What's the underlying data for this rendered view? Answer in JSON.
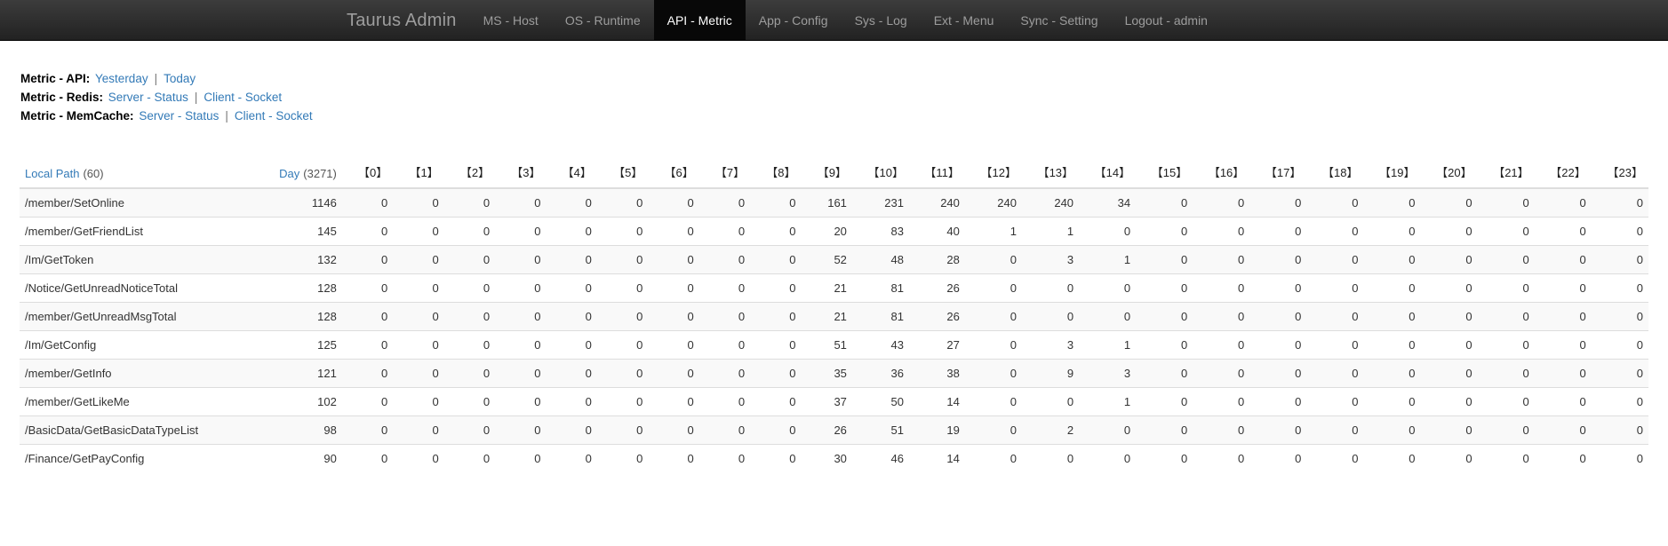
{
  "navbar": {
    "brand": "Taurus Admin",
    "items": [
      {
        "label": "MS - Host",
        "active": false
      },
      {
        "label": "OS - Runtime",
        "active": false
      },
      {
        "label": "API - Metric",
        "active": true
      },
      {
        "label": "App - Config",
        "active": false
      },
      {
        "label": "Sys - Log",
        "active": false
      },
      {
        "label": "Ext - Menu",
        "active": false
      },
      {
        "label": "Sync - Setting",
        "active": false
      },
      {
        "label": "Logout - admin",
        "active": false
      }
    ]
  },
  "metric_links": [
    {
      "label": "Metric - API:",
      "links": [
        "Yesterday",
        "Today"
      ],
      "separator": "|"
    },
    {
      "label": "Metric - Redis:",
      "links": [
        "Server - Status",
        "Client - Socket"
      ],
      "separator": "|"
    },
    {
      "label": "Metric - MemCache:",
      "links": [
        "Server - Status",
        "Client - Socket"
      ],
      "separator": "|"
    }
  ],
  "table": {
    "header": {
      "path_label": "Local Path",
      "path_count": "(60)",
      "day_label": "Day",
      "day_count": "(3271)",
      "hours": [
        "【0】",
        "【1】",
        "【2】",
        "【3】",
        "【4】",
        "【5】",
        "【6】",
        "【7】",
        "【8】",
        "【9】",
        "【10】",
        "【11】",
        "【12】",
        "【13】",
        "【14】",
        "【15】",
        "【16】",
        "【17】",
        "【18】",
        "【19】",
        "【20】",
        "【21】",
        "【22】",
        "【23】"
      ]
    },
    "rows": [
      {
        "path": "/member/SetOnline",
        "day": "1146",
        "hours": [
          "0",
          "0",
          "0",
          "0",
          "0",
          "0",
          "0",
          "0",
          "0",
          "161",
          "231",
          "240",
          "240",
          "240",
          "34",
          "0",
          "0",
          "0",
          "0",
          "0",
          "0",
          "0",
          "0",
          "0"
        ]
      },
      {
        "path": "/member/GetFriendList",
        "day": "145",
        "hours": [
          "0",
          "0",
          "0",
          "0",
          "0",
          "0",
          "0",
          "0",
          "0",
          "20",
          "83",
          "40",
          "1",
          "1",
          "0",
          "0",
          "0",
          "0",
          "0",
          "0",
          "0",
          "0",
          "0",
          "0"
        ]
      },
      {
        "path": "/Im/GetToken",
        "day": "132",
        "hours": [
          "0",
          "0",
          "0",
          "0",
          "0",
          "0",
          "0",
          "0",
          "0",
          "52",
          "48",
          "28",
          "0",
          "3",
          "1",
          "0",
          "0",
          "0",
          "0",
          "0",
          "0",
          "0",
          "0",
          "0"
        ]
      },
      {
        "path": "/Notice/GetUnreadNoticeTotal",
        "day": "128",
        "hours": [
          "0",
          "0",
          "0",
          "0",
          "0",
          "0",
          "0",
          "0",
          "0",
          "21",
          "81",
          "26",
          "0",
          "0",
          "0",
          "0",
          "0",
          "0",
          "0",
          "0",
          "0",
          "0",
          "0",
          "0"
        ]
      },
      {
        "path": "/member/GetUnreadMsgTotal",
        "day": "128",
        "hours": [
          "0",
          "0",
          "0",
          "0",
          "0",
          "0",
          "0",
          "0",
          "0",
          "21",
          "81",
          "26",
          "0",
          "0",
          "0",
          "0",
          "0",
          "0",
          "0",
          "0",
          "0",
          "0",
          "0",
          "0"
        ]
      },
      {
        "path": "/Im/GetConfig",
        "day": "125",
        "hours": [
          "0",
          "0",
          "0",
          "0",
          "0",
          "0",
          "0",
          "0",
          "0",
          "51",
          "43",
          "27",
          "0",
          "3",
          "1",
          "0",
          "0",
          "0",
          "0",
          "0",
          "0",
          "0",
          "0",
          "0"
        ]
      },
      {
        "path": "/member/GetInfo",
        "day": "121",
        "hours": [
          "0",
          "0",
          "0",
          "0",
          "0",
          "0",
          "0",
          "0",
          "0",
          "35",
          "36",
          "38",
          "0",
          "9",
          "3",
          "0",
          "0",
          "0",
          "0",
          "0",
          "0",
          "0",
          "0",
          "0"
        ]
      },
      {
        "path": "/member/GetLikeMe",
        "day": "102",
        "hours": [
          "0",
          "0",
          "0",
          "0",
          "0",
          "0",
          "0",
          "0",
          "0",
          "37",
          "50",
          "14",
          "0",
          "0",
          "1",
          "0",
          "0",
          "0",
          "0",
          "0",
          "0",
          "0",
          "0",
          "0"
        ]
      },
      {
        "path": "/BasicData/GetBasicDataTypeList",
        "day": "98",
        "hours": [
          "0",
          "0",
          "0",
          "0",
          "0",
          "0",
          "0",
          "0",
          "0",
          "26",
          "51",
          "19",
          "0",
          "2",
          "0",
          "0",
          "0",
          "0",
          "0",
          "0",
          "0",
          "0",
          "0",
          "0"
        ]
      },
      {
        "path": "/Finance/GetPayConfig",
        "day": "90",
        "hours": [
          "0",
          "0",
          "0",
          "0",
          "0",
          "0",
          "0",
          "0",
          "0",
          "30",
          "46",
          "14",
          "0",
          "0",
          "0",
          "0",
          "0",
          "0",
          "0",
          "0",
          "0",
          "0",
          "0",
          "0"
        ]
      }
    ]
  },
  "colors": {
    "link": "#337ab7",
    "navbar_bg": "#222222",
    "navbar_active_bg": "#080808",
    "navbar_text": "#9d9d9d"
  }
}
